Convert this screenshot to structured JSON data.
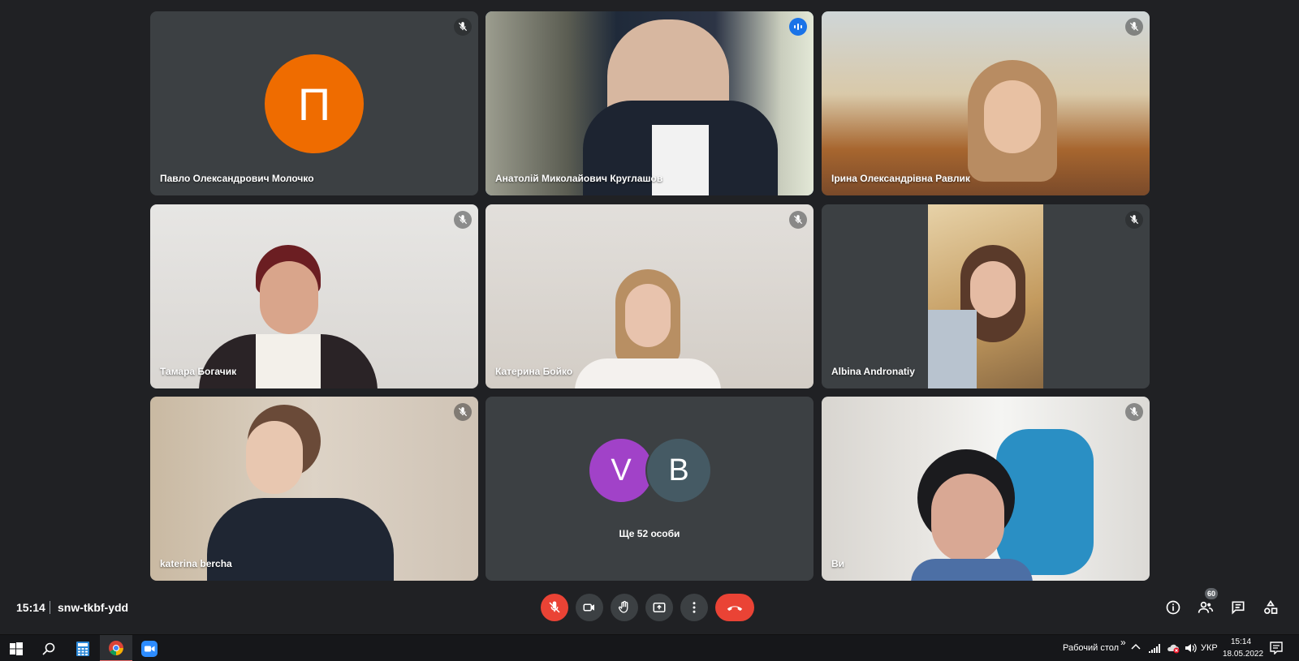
{
  "participants": [
    {
      "name": "Павло Олександрович Молочко",
      "avatar_letter": "П",
      "avatar_color": "#ef6c00",
      "muted": true
    },
    {
      "name": "Анатолій Миколайович Круглашов",
      "speaking": true
    },
    {
      "name": "Ірина Олександрівна Равлик",
      "muted": true
    },
    {
      "name": "Тамара Богачик",
      "muted": true
    },
    {
      "name": "Катерина Бойко",
      "muted": true
    },
    {
      "name": "Albina Andronatiy",
      "muted": true
    },
    {
      "name": "katerina bercha",
      "muted": true
    },
    {
      "name": "Ви",
      "muted": true
    }
  ],
  "others_tile": {
    "avatars": [
      {
        "letter": "V",
        "color": "#a142c8"
      },
      {
        "letter": "B",
        "color": "#455a64"
      }
    ],
    "label": "Ще 52 особи"
  },
  "meeting": {
    "time": "15:14",
    "code": "snw-tkbf-ydd",
    "participant_count": "60"
  },
  "taskbar": {
    "desktop_label": "Рабочий стол",
    "chevron": "»",
    "language": "УКР",
    "clock_time": "15:14",
    "clock_date": "18.05.2022"
  },
  "colors": {
    "background": "#202124",
    "tile": "#3c4043",
    "active_speaker_border": "#8ab4f8",
    "danger": "#ea4335"
  }
}
